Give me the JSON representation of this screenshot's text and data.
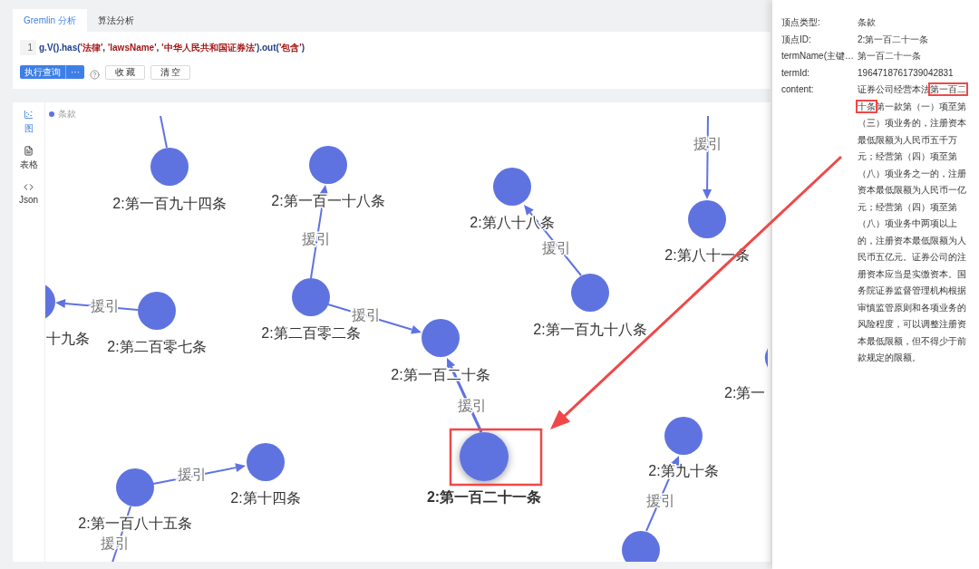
{
  "query_panel": {
    "tabs": [
      {
        "label": "Gremlin 分析",
        "selected": true
      },
      {
        "label": "算法分析",
        "selected": false
      }
    ],
    "editor": {
      "line_number": "1",
      "tokens": [
        {
          "kind": "call",
          "text": "g.V().has("
        },
        {
          "kind": "string",
          "text": "'法律'"
        },
        {
          "kind": "punct",
          "text": ", "
        },
        {
          "kind": "string",
          "text": "'lawsName'"
        },
        {
          "kind": "punct",
          "text": ", "
        },
        {
          "kind": "string",
          "text": "'中华人民共和国证券法'"
        },
        {
          "kind": "call",
          "text": ").out("
        },
        {
          "kind": "string",
          "text": "'包含'"
        },
        {
          "kind": "call",
          "text": ")"
        }
      ]
    },
    "run_button": {
      "label": "执行查询",
      "more": "···"
    },
    "buttons": [
      "收 藏",
      "清 空"
    ]
  },
  "result_panel": {
    "views": [
      {
        "kind": "graph",
        "label": "图",
        "selected": true
      },
      {
        "kind": "table",
        "label": "表格",
        "selected": false
      },
      {
        "kind": "code",
        "label": "Json",
        "selected": false
      }
    ],
    "legend": {
      "label": "条款",
      "color": "#5f73e0"
    },
    "graph": {
      "nodes": [
        {
          "label": "2:第一百九十四条",
          "selected": false
        },
        {
          "label": "2:第一百一十八条",
          "selected": false
        },
        {
          "label": "2:第二百零二条",
          "selected": false
        },
        {
          "label": "2:第一百二十条",
          "selected": false
        },
        {
          "label": "2:第八十八条",
          "selected": false
        },
        {
          "label": "2:第一百九十八条",
          "selected": false
        },
        {
          "label": "2:第八十一条",
          "selected": false
        },
        {
          "label": "2:第二百零七条",
          "selected": false
        },
        {
          "label": "十九条",
          "selected": false
        },
        {
          "label": "2:第一百二十一条",
          "selected": true
        },
        {
          "label": "2:第一百八十五条",
          "selected": false
        },
        {
          "label": "2:第十四条",
          "selected": false
        },
        {
          "label": "2:第九十条",
          "selected": false
        },
        {
          "selected": false
        },
        {
          "label": "2:第一",
          "selected": false
        }
      ],
      "edges": [
        {
          "arrow": false
        },
        {
          "label": "援引",
          "arrow": true
        },
        {
          "label": "援引",
          "arrow": true
        },
        {
          "label": "援引",
          "arrow": true
        },
        {
          "label": "援引",
          "arrow": true
        },
        {
          "label": "援引",
          "arrow": true
        },
        {
          "label": "援引",
          "arrow": true
        },
        {
          "label": "援引",
          "arrow": true
        },
        {
          "label": "援引",
          "arrow": false
        },
        {
          "label": "援引",
          "arrow": true
        }
      ]
    }
  },
  "details_panel": {
    "rows": [
      {
        "key": "顶点类型:",
        "value": "条款"
      },
      {
        "key": "顶点ID:",
        "value": "2:第一百二十一条"
      },
      {
        "key": "termName(主键…",
        "value": "第一百二十一条"
      },
      {
        "key": "termId:",
        "value": "1964718761739042831"
      },
      {
        "key": "content:",
        "value": "证券公司经营本法",
        "highlight": "第一百二十条",
        "value_after": "第一款第（一）项至第（三）项业务的，注册资本最低限额为人民币五千万元；经营第（四）项至第（八）项业务之一的，注册资本最低限额为人民币一亿元；经营第（四）项至第（八）项业务中两项以上的，注册资本最低限额为人民币五亿元。证券公司的注册资本应当是实缴资本。国务院证券监督管理机构根据审慎监管原则和各项业务的风险程度，可以调整注册资本最低限额，但不得少于前款规定的限额。"
      }
    ]
  },
  "annotation": {
    "kind": "callout"
  }
}
